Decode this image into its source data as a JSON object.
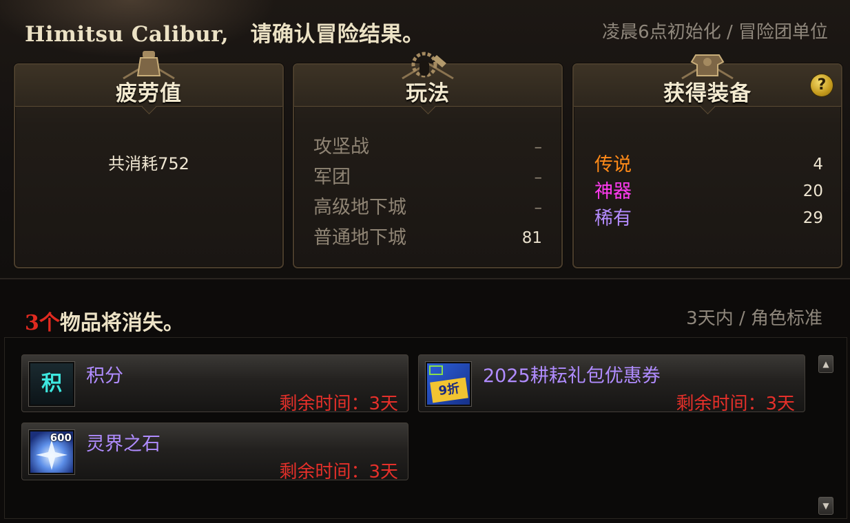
{
  "header": {
    "title": "Himitsu Calibur,　请确认冒险结果。",
    "note": "凌晨6点初始化 / 冒险团单位"
  },
  "fatigue": {
    "title": "疲劳值",
    "text": "共消耗752"
  },
  "modes": {
    "title": "玩法",
    "rows": [
      {
        "name": "攻坚战",
        "value": "–"
      },
      {
        "name": "军团",
        "value": "–"
      },
      {
        "name": "高级地下城",
        "value": "–"
      },
      {
        "name": "普通地下城",
        "value": "81"
      }
    ]
  },
  "gear": {
    "title": "获得装备",
    "help": "?",
    "rows": [
      {
        "name": "传说",
        "count": "4",
        "color": "#ff8a18"
      },
      {
        "name": "神器",
        "count": "20",
        "color": "#ff3af0"
      },
      {
        "name": "稀有",
        "count": "29",
        "color": "#b58cff"
      }
    ]
  },
  "expiring": {
    "count": "3个",
    "label": "物品将消失。",
    "note": "3天内 / 角色标准",
    "items": [
      {
        "name": "积分",
        "time": "剩余时间：3天",
        "icon_text": "积",
        "icon": "points-icon"
      },
      {
        "name": "2025耕耘礼包优惠券",
        "time": "剩余时间：3天",
        "icon_text": "9折",
        "icon": "coupon-icon"
      },
      {
        "name": "灵界之石",
        "time": "剩余时间：3天",
        "icon_text": "600",
        "icon": "crystal-icon"
      }
    ]
  },
  "scrollbar": {
    "up": "▲",
    "down": "▼"
  }
}
